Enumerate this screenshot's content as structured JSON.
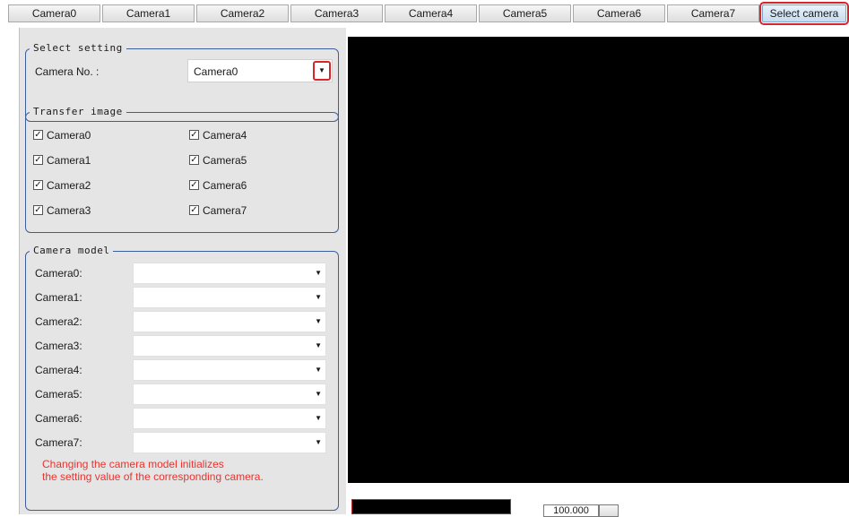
{
  "tabs": [
    {
      "label": "Camera0"
    },
    {
      "label": "Camera1"
    },
    {
      "label": "Camera2"
    },
    {
      "label": "Camera3"
    },
    {
      "label": "Camera4"
    },
    {
      "label": "Camera5"
    },
    {
      "label": "Camera6"
    },
    {
      "label": "Camera7"
    },
    {
      "label": "Select camera"
    }
  ],
  "active_tab": "Select camera",
  "select_setting": {
    "title": "Select setting",
    "camera_no_label": "Camera No. :",
    "camera_no_value": "Camera0"
  },
  "transfer_image": {
    "title": "Transfer image",
    "items": [
      {
        "label": "Camera0",
        "checked": true
      },
      {
        "label": "Camera4",
        "checked": true
      },
      {
        "label": "Camera1",
        "checked": true
      },
      {
        "label": "Camera5",
        "checked": true
      },
      {
        "label": "Camera2",
        "checked": true
      },
      {
        "label": "Camera6",
        "checked": true
      },
      {
        "label": "Camera3",
        "checked": true
      },
      {
        "label": "Camera7",
        "checked": true
      }
    ]
  },
  "camera_model": {
    "title": "Camera model",
    "rows": [
      {
        "label": "Camera0:",
        "value": ""
      },
      {
        "label": "Camera1:",
        "value": ""
      },
      {
        "label": "Camera2:",
        "value": ""
      },
      {
        "label": "Camera3:",
        "value": ""
      },
      {
        "label": "Camera4:",
        "value": ""
      },
      {
        "label": "Camera5:",
        "value": ""
      },
      {
        "label": "Camera6:",
        "value": ""
      },
      {
        "label": "Camera7:",
        "value": ""
      }
    ],
    "note_line1": "Changing the camera model initializes",
    "note_line2": "the setting value of the corresponding camera."
  },
  "zoom": {
    "value": "100.000"
  },
  "colors": {
    "highlight": "#d9252a",
    "group_border": "#3d5f9c",
    "warning_text": "#e8342f",
    "viewer_bg": "#000000"
  },
  "icons": {
    "dropdown": "chevron-down-icon",
    "checkbox": "check-icon"
  }
}
